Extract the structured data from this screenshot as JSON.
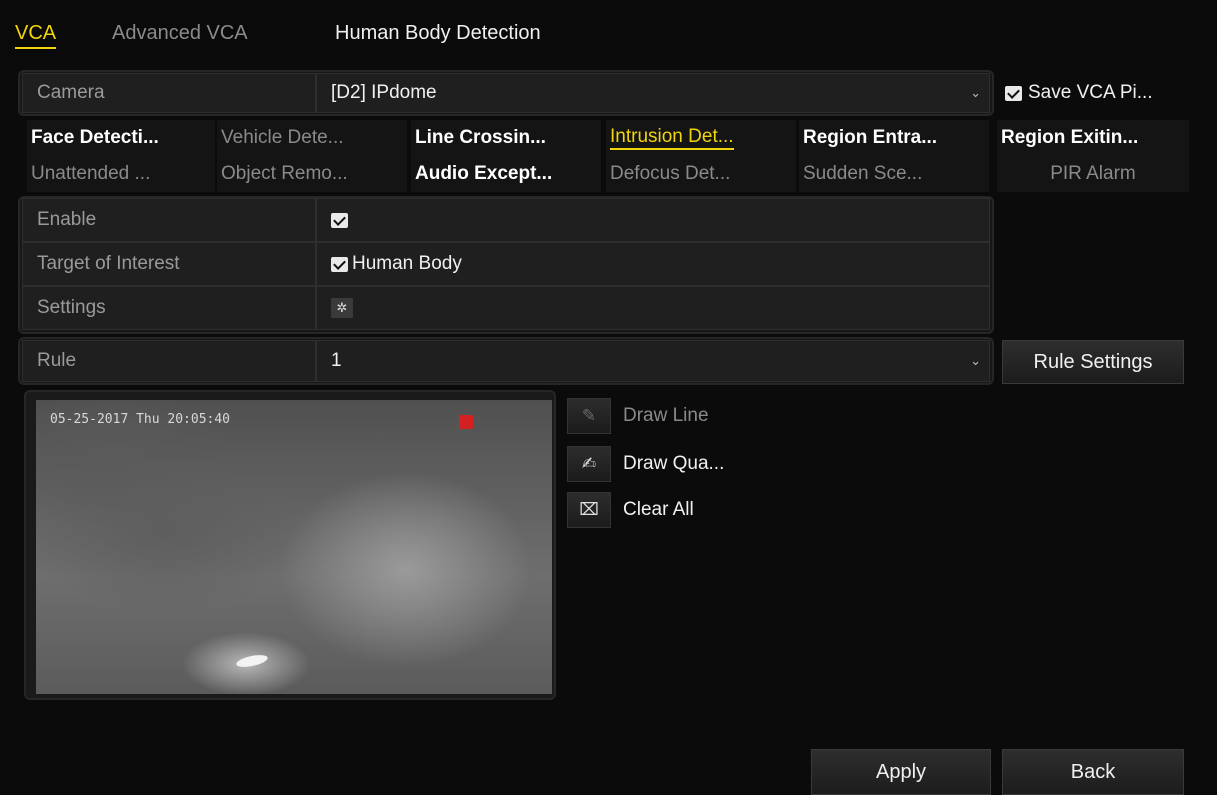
{
  "tabs": [
    {
      "label": "VCA"
    },
    {
      "label": "Advanced VCA"
    },
    {
      "label": "Human Body Detection"
    }
  ],
  "camera": {
    "label": "Camera",
    "value": "[D2] IPdome"
  },
  "save_vca_picture": {
    "label": "Save VCA Pi...",
    "checked": true
  },
  "event_tabs_row1": [
    {
      "label": "Face Detecti...",
      "state": "enabled"
    },
    {
      "label": "Vehicle Dete...",
      "state": "disabled"
    },
    {
      "label": "Line Crossin...",
      "state": "enabled"
    },
    {
      "label": "Intrusion Det...",
      "state": "selected"
    },
    {
      "label": "Region Entra...",
      "state": "enabled"
    },
    {
      "label": "Region Exitin...",
      "state": "enabled"
    }
  ],
  "event_tabs_row2": [
    {
      "label": "Unattended ...",
      "state": "disabled"
    },
    {
      "label": "Object Remo...",
      "state": "disabled"
    },
    {
      "label": "Audio Except...",
      "state": "enabled"
    },
    {
      "label": "Defocus Det...",
      "state": "disabled"
    },
    {
      "label": "Sudden Sce...",
      "state": "disabled"
    },
    {
      "label": "PIR Alarm",
      "state": "disabled"
    }
  ],
  "settings_rows": [
    {
      "label": "Enable"
    },
    {
      "label": "Target of Interest",
      "value": "Human Body"
    },
    {
      "label": "Settings"
    }
  ],
  "rule": {
    "label": "Rule",
    "value": "1"
  },
  "rule_settings_button": "Rule Settings",
  "preview": {
    "osd_datetime": "05-25-2017 Thu 20:05:40"
  },
  "draw_tools": [
    {
      "label": "Draw Line",
      "icon": "pencil-icon",
      "enabled": false
    },
    {
      "label": "Draw Qua...",
      "icon": "edit-box-icon",
      "enabled": true
    },
    {
      "label": "Clear All",
      "icon": "clear-icon",
      "enabled": true
    }
  ],
  "buttons": {
    "apply": "Apply",
    "back": "Back"
  },
  "colors": {
    "accent": "#f2d40b",
    "background": "#0b0b0b"
  }
}
